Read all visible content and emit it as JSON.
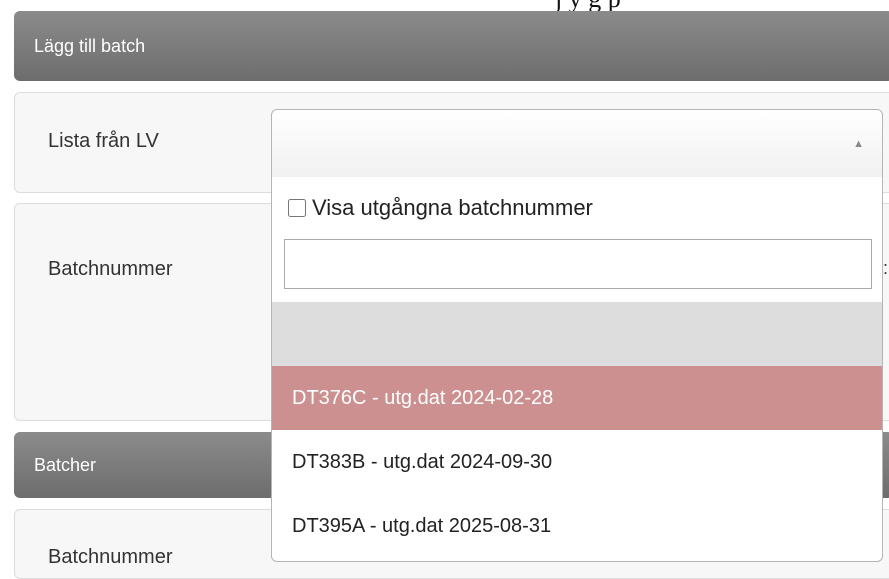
{
  "top_partial_text": "j         y         g         p",
  "add_batch": {
    "header": "Lägg till batch",
    "list_label": "Lista från LV",
    "select_arrow": "▲",
    "batch_label": "Batchnummer"
  },
  "dropdown": {
    "show_expired_label": "Visa utgångna batchnummer",
    "search_value": "",
    "options": [
      {
        "label": ""
      },
      {
        "label": "DT376C - utg.dat 2024-02-28"
      },
      {
        "label": "DT383B - utg.dat 2024-09-30"
      },
      {
        "label": "DT395A - utg.dat 2025-08-31"
      }
    ],
    "highlighted_index": 1
  },
  "batches": {
    "header": "Batcher",
    "batch_label": "Batchnummer"
  }
}
